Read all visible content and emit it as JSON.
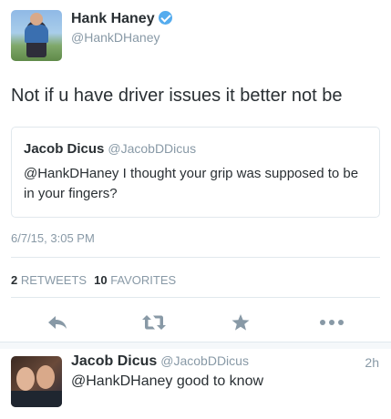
{
  "tweet": {
    "author_name": "Hank Haney",
    "author_handle": "@HankDHaney",
    "text": "Not if u have driver issues it better not be",
    "timestamp": "6/7/15, 3:05 PM"
  },
  "quoted": {
    "author_name": "Jacob Dicus",
    "author_handle": "@JacobDDicus",
    "text": "@HankDHaney I thought your grip was supposed to be in your fingers?"
  },
  "stats": {
    "retweets_count": "2",
    "retweets_label": "RETWEETS",
    "favorites_count": "10",
    "favorites_label": "FAVORITES"
  },
  "actions": [
    "reply-icon",
    "retweet-icon",
    "favorite-icon",
    "more-icon"
  ],
  "reply": {
    "author_name": "Jacob Dicus",
    "author_handle": "@JacobDDicus",
    "time": "2h",
    "text": "@HankDHaney good to know"
  },
  "colors": {
    "text": "#292f33",
    "muted": "#8899a6",
    "border": "#e1e8ed",
    "verified": "#55acee"
  }
}
